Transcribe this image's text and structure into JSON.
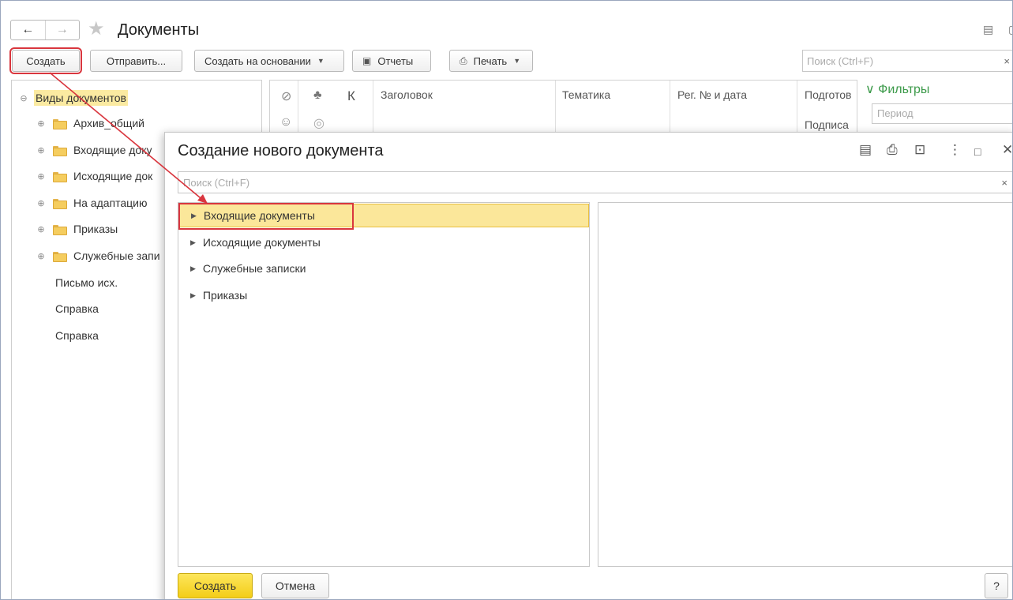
{
  "window": {
    "title": "Документы",
    "nav_back": "←",
    "nav_forward": "→"
  },
  "toolbar": {
    "create": "Создать",
    "send": "Отправить...",
    "create_based_on": "Создать на основании",
    "reports": "Отчеты",
    "print": "Печать",
    "search_placeholder": "Поиск (Ctrl+F)"
  },
  "tree": {
    "root": "Виды документов",
    "folders": [
      "Архив_общий",
      "Входящие доку",
      "Исходящие док",
      "На адаптацию",
      "Приказы",
      "Служебные запи"
    ],
    "items": [
      "Письмо исх.",
      "Справка",
      "Справка"
    ]
  },
  "grid": {
    "columns": [
      "К",
      "Заголовок",
      "Тематика",
      "Рег. № и дата",
      "Подготов",
      "Подписа"
    ]
  },
  "filters": {
    "title": "Фильтры",
    "period_placeholder": "Период"
  },
  "modal": {
    "title": "Создание нового документа",
    "search_placeholder": "Поиск (Ctrl+F)",
    "items": [
      "Входящие документы",
      "Исходящие документы",
      "Служебные записки",
      "Приказы"
    ],
    "selected_index": 0,
    "create_button": "Создать",
    "cancel_button": "Отмена",
    "help_button": "?"
  },
  "colors": {
    "highlight_red": "#d9363e",
    "selection_yellow": "#fbe79a",
    "create_button_yellow": "#f3cd18",
    "filters_green": "#3c9a4a"
  }
}
